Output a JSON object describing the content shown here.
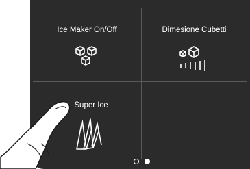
{
  "tiles": [
    {
      "label": "Ice Maker On/Off",
      "icon": "ice-cubes-icon"
    },
    {
      "label": "Dimesione Cubetti",
      "icon": "cube-size-icon"
    },
    {
      "label": "Super Ice",
      "icon": "super-ice-icon"
    },
    {
      "label": "",
      "icon": ""
    }
  ],
  "pager": {
    "pages": 2,
    "current": 2
  },
  "colors": {
    "panel": "#2b2b2b",
    "divider": "#5a5a5a",
    "foreground": "#ffffff"
  }
}
